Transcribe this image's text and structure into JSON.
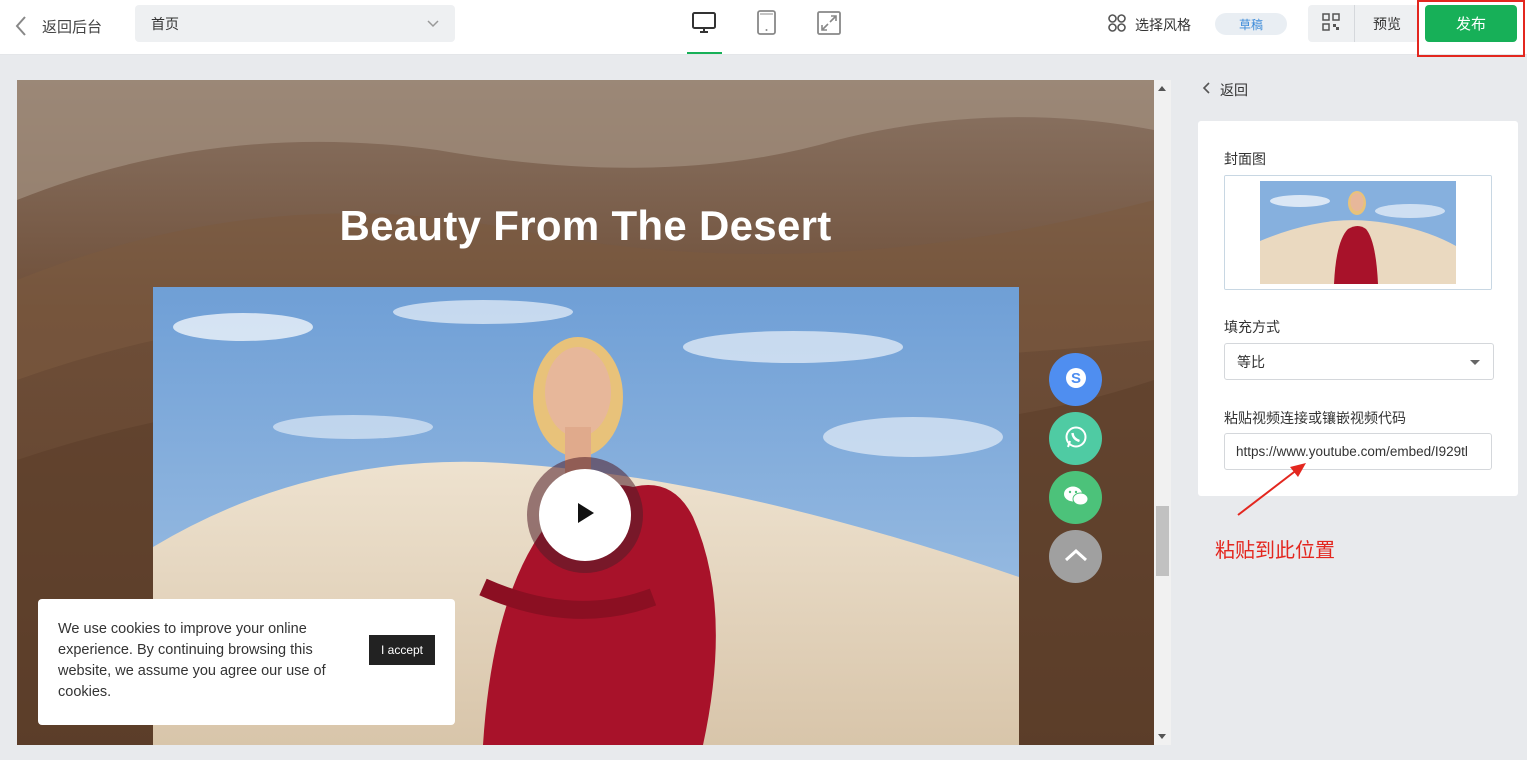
{
  "topbar": {
    "back_label": "返回后台",
    "page_select_value": "首页",
    "style_label": "选择风格",
    "draft_badge": "草稿",
    "preview_label": "预览",
    "publish_label": "发布"
  },
  "canvas": {
    "hero_title": "Beauty From The Desert",
    "cookie_text": "We use cookies to improve your online experience. By continuing browsing this website, we assume you agree our use of cookies.",
    "cookie_accept": "I accept"
  },
  "panel": {
    "back_label": "返回",
    "cover_label": "封面图",
    "fill_label": "填充方式",
    "fill_value": "等比",
    "video_label": "粘贴视频连接或镶嵌视频代码",
    "video_url": "https://www.youtube.com/embed/I929tl"
  },
  "annotation": {
    "text": "粘贴到此位置"
  },
  "colors": {
    "accent_green": "#17b058",
    "annotation_red": "#e3271f",
    "skype": "#4f8ef0",
    "whatsapp": "#4fcba3",
    "wechat": "#4cc27a",
    "scroll_top": "#a0a0a0"
  }
}
